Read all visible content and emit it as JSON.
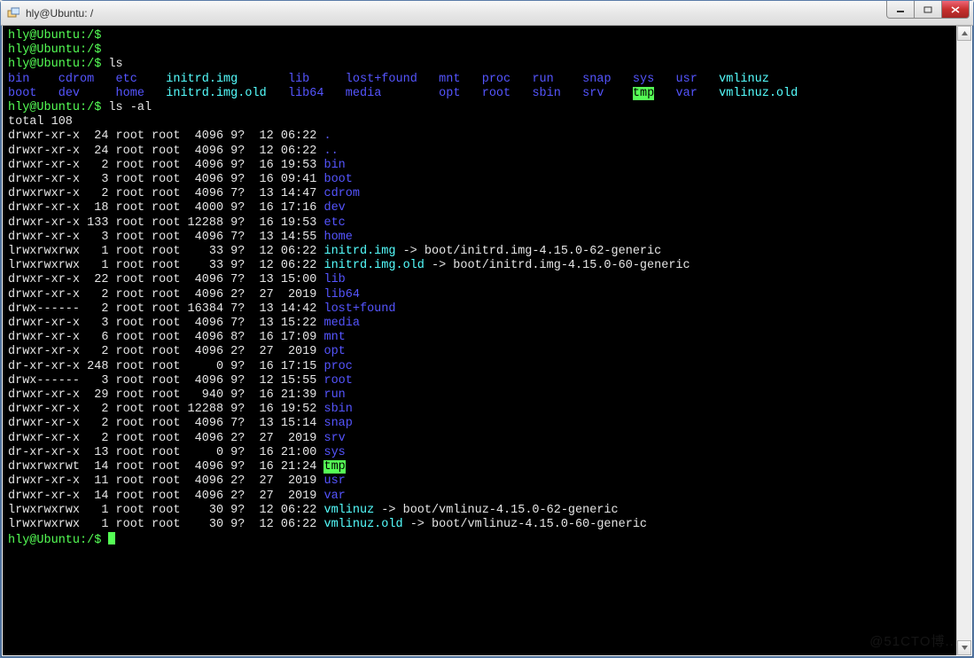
{
  "window": {
    "title": "hly@Ubuntu: /"
  },
  "prompt": "hly@Ubuntu:/$",
  "cmd_ls": "ls",
  "cmd_lsal": "ls -al",
  "total": "total 108",
  "watermark": "@51CTO博...",
  "ls_rows": [
    [
      {
        "t": "bin",
        "c": "c-dir"
      },
      {
        "t": "cdrom",
        "c": "c-dir"
      },
      {
        "t": "etc",
        "c": "c-dir"
      },
      {
        "t": "initrd.img",
        "c": "c-link",
        "w": 15
      },
      {
        "t": "lib",
        "c": "c-dir",
        "w": 6
      },
      {
        "t": "lost+found",
        "c": "c-dir",
        "w": 11
      },
      {
        "t": "mnt",
        "c": "c-dir",
        "w": 4
      },
      {
        "t": "proc",
        "c": "c-dir",
        "w": 5
      },
      {
        "t": "run",
        "c": "c-dir",
        "w": 5
      },
      {
        "t": "snap",
        "c": "c-dir",
        "w": 5
      },
      {
        "t": "sys",
        "c": "c-dir",
        "w": 4
      },
      {
        "t": "usr",
        "c": "c-dir",
        "w": 4
      },
      {
        "t": "vmlinuz",
        "c": "c-link"
      }
    ],
    [
      {
        "t": "boot",
        "c": "c-dir"
      },
      {
        "t": "dev",
        "c": "c-dir"
      },
      {
        "t": "home",
        "c": "c-dir"
      },
      {
        "t": "initrd.img.old",
        "c": "c-link",
        "w": 15
      },
      {
        "t": "lib64",
        "c": "c-dir",
        "w": 6
      },
      {
        "t": "media",
        "c": "c-dir",
        "w": 11
      },
      {
        "t": "opt",
        "c": "c-dir",
        "w": 4
      },
      {
        "t": "root",
        "c": "c-dir",
        "w": 5
      },
      {
        "t": "sbin",
        "c": "c-dir",
        "w": 5
      },
      {
        "t": "srv",
        "c": "c-dir",
        "w": 5
      },
      {
        "t": "tmp",
        "c": "c-hl",
        "w": 4
      },
      {
        "t": "var",
        "c": "c-dir",
        "w": 4
      },
      {
        "t": "vmlinuz.old",
        "c": "c-link"
      }
    ]
  ],
  "ls_col_widths": [
    5,
    6,
    5
  ],
  "details": [
    {
      "perm": "drwxr-xr-x",
      "n": "24",
      "o": "root",
      "g": "root",
      "s": "4096",
      "m": "9?",
      "d": "12",
      "t": "06:22",
      "name": ".",
      "nc": "c-dir"
    },
    {
      "perm": "drwxr-xr-x",
      "n": "24",
      "o": "root",
      "g": "root",
      "s": "4096",
      "m": "9?",
      "d": "12",
      "t": "06:22",
      "name": "..",
      "nc": "c-dir"
    },
    {
      "perm": "drwxr-xr-x",
      "n": "2",
      "o": "root",
      "g": "root",
      "s": "4096",
      "m": "9?",
      "d": "16",
      "t": "19:53",
      "name": "bin",
      "nc": "c-dir"
    },
    {
      "perm": "drwxr-xr-x",
      "n": "3",
      "o": "root",
      "g": "root",
      "s": "4096",
      "m": "9?",
      "d": "16",
      "t": "09:41",
      "name": "boot",
      "nc": "c-dir"
    },
    {
      "perm": "drwxrwxr-x",
      "n": "2",
      "o": "root",
      "g": "root",
      "s": "4096",
      "m": "7?",
      "d": "13",
      "t": "14:47",
      "name": "cdrom",
      "nc": "c-dir"
    },
    {
      "perm": "drwxr-xr-x",
      "n": "18",
      "o": "root",
      "g": "root",
      "s": "4000",
      "m": "9?",
      "d": "16",
      "t": "17:16",
      "name": "dev",
      "nc": "c-dir"
    },
    {
      "perm": "drwxr-xr-x",
      "n": "133",
      "o": "root",
      "g": "root",
      "s": "12288",
      "m": "9?",
      "d": "16",
      "t": "19:53",
      "name": "etc",
      "nc": "c-dir"
    },
    {
      "perm": "drwxr-xr-x",
      "n": "3",
      "o": "root",
      "g": "root",
      "s": "4096",
      "m": "7?",
      "d": "13",
      "t": "14:55",
      "name": "home",
      "nc": "c-dir"
    },
    {
      "perm": "lrwxrwxrwx",
      "n": "1",
      "o": "root",
      "g": "root",
      "s": "33",
      "m": "9?",
      "d": "12",
      "t": "06:22",
      "name": "initrd.img",
      "nc": "c-link",
      "tgt": "boot/initrd.img-4.15.0-62-generic"
    },
    {
      "perm": "lrwxrwxrwx",
      "n": "1",
      "o": "root",
      "g": "root",
      "s": "33",
      "m": "9?",
      "d": "12",
      "t": "06:22",
      "name": "initrd.img.old",
      "nc": "c-link",
      "tgt": "boot/initrd.img-4.15.0-60-generic"
    },
    {
      "perm": "drwxr-xr-x",
      "n": "22",
      "o": "root",
      "g": "root",
      "s": "4096",
      "m": "7?",
      "d": "13",
      "t": "15:00",
      "name": "lib",
      "nc": "c-dir"
    },
    {
      "perm": "drwxr-xr-x",
      "n": "2",
      "o": "root",
      "g": "root",
      "s": "4096",
      "m": "2?",
      "d": "27",
      "t": "2019",
      "name": "lib64",
      "nc": "c-dir"
    },
    {
      "perm": "drwx------",
      "n": "2",
      "o": "root",
      "g": "root",
      "s": "16384",
      "m": "7?",
      "d": "13",
      "t": "14:42",
      "name": "lost+found",
      "nc": "c-dir"
    },
    {
      "perm": "drwxr-xr-x",
      "n": "3",
      "o": "root",
      "g": "root",
      "s": "4096",
      "m": "7?",
      "d": "13",
      "t": "15:22",
      "name": "media",
      "nc": "c-dir"
    },
    {
      "perm": "drwxr-xr-x",
      "n": "6",
      "o": "root",
      "g": "root",
      "s": "4096",
      "m": "8?",
      "d": "16",
      "t": "17:09",
      "name": "mnt",
      "nc": "c-dir"
    },
    {
      "perm": "drwxr-xr-x",
      "n": "2",
      "o": "root",
      "g": "root",
      "s": "4096",
      "m": "2?",
      "d": "27",
      "t": "2019",
      "name": "opt",
      "nc": "c-dir"
    },
    {
      "perm": "dr-xr-xr-x",
      "n": "248",
      "o": "root",
      "g": "root",
      "s": "0",
      "m": "9?",
      "d": "16",
      "t": "17:15",
      "name": "proc",
      "nc": "c-dir"
    },
    {
      "perm": "drwx------",
      "n": "3",
      "o": "root",
      "g": "root",
      "s": "4096",
      "m": "9?",
      "d": "12",
      "t": "15:55",
      "name": "root",
      "nc": "c-dir"
    },
    {
      "perm": "drwxr-xr-x",
      "n": "29",
      "o": "root",
      "g": "root",
      "s": "940",
      "m": "9?",
      "d": "16",
      "t": "21:39",
      "name": "run",
      "nc": "c-dir"
    },
    {
      "perm": "drwxr-xr-x",
      "n": "2",
      "o": "root",
      "g": "root",
      "s": "12288",
      "m": "9?",
      "d": "16",
      "t": "19:52",
      "name": "sbin",
      "nc": "c-dir"
    },
    {
      "perm": "drwxr-xr-x",
      "n": "2",
      "o": "root",
      "g": "root",
      "s": "4096",
      "m": "7?",
      "d": "13",
      "t": "15:14",
      "name": "snap",
      "nc": "c-dir"
    },
    {
      "perm": "drwxr-xr-x",
      "n": "2",
      "o": "root",
      "g": "root",
      "s": "4096",
      "m": "2?",
      "d": "27",
      "t": "2019",
      "name": "srv",
      "nc": "c-dir"
    },
    {
      "perm": "dr-xr-xr-x",
      "n": "13",
      "o": "root",
      "g": "root",
      "s": "0",
      "m": "9?",
      "d": "16",
      "t": "21:00",
      "name": "sys",
      "nc": "c-dir"
    },
    {
      "perm": "drwxrwxrwt",
      "n": "14",
      "o": "root",
      "g": "root",
      "s": "4096",
      "m": "9?",
      "d": "16",
      "t": "21:24",
      "name": "tmp",
      "nc": "c-hl"
    },
    {
      "perm": "drwxr-xr-x",
      "n": "11",
      "o": "root",
      "g": "root",
      "s": "4096",
      "m": "2?",
      "d": "27",
      "t": "2019",
      "name": "usr",
      "nc": "c-dir"
    },
    {
      "perm": "drwxr-xr-x",
      "n": "14",
      "o": "root",
      "g": "root",
      "s": "4096",
      "m": "2?",
      "d": "27",
      "t": "2019",
      "name": "var",
      "nc": "c-dir"
    },
    {
      "perm": "lrwxrwxrwx",
      "n": "1",
      "o": "root",
      "g": "root",
      "s": "30",
      "m": "9?",
      "d": "12",
      "t": "06:22",
      "name": "vmlinuz",
      "nc": "c-link",
      "tgt": "boot/vmlinuz-4.15.0-62-generic"
    },
    {
      "perm": "lrwxrwxrwx",
      "n": "1",
      "o": "root",
      "g": "root",
      "s": "30",
      "m": "9?",
      "d": "12",
      "t": "06:22",
      "name": "vmlinuz.old",
      "nc": "c-link",
      "tgt": "boot/vmlinuz-4.15.0-60-generic"
    }
  ]
}
